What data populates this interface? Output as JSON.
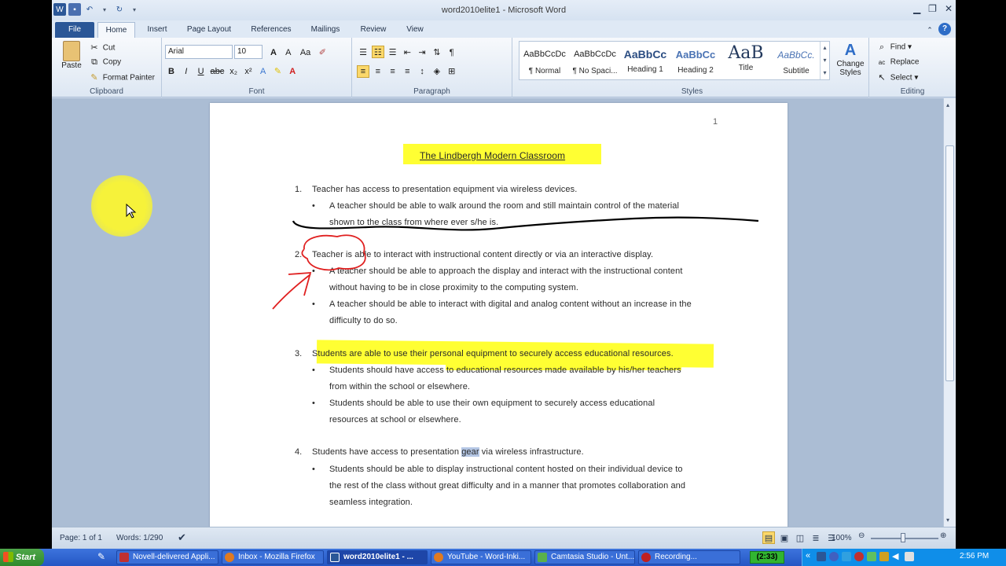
{
  "window": {
    "title": "word2010elite1 - Microsoft Word"
  },
  "tabs": [
    "File",
    "Home",
    "Insert",
    "Page Layout",
    "References",
    "Mailings",
    "Review",
    "View"
  ],
  "clipboard": {
    "paste": "Paste",
    "cut": "Cut",
    "copy": "Copy",
    "format_painter": "Format Painter",
    "label": "Clipboard"
  },
  "font": {
    "family": "Arial",
    "size": "10",
    "label": "Font"
  },
  "paragraph": {
    "label": "Paragraph"
  },
  "styles": {
    "label": "Styles",
    "items": [
      {
        "preview": "AaBbCcDc",
        "name": "¶ Normal"
      },
      {
        "preview": "AaBbCcDc",
        "name": "¶ No Spaci..."
      },
      {
        "preview": "AaBbCc",
        "name": "Heading 1"
      },
      {
        "preview": "AaBbCc",
        "name": "Heading 2"
      },
      {
        "preview": "AaB",
        "name": "Title"
      },
      {
        "preview": "AaBbCc.",
        "name": "Subtitle"
      }
    ],
    "change_styles": "Change Styles"
  },
  "editing": {
    "find": "Find",
    "replace": "Replace",
    "select": "Select",
    "label": "Editing"
  },
  "document": {
    "page_number": "1",
    "title": "The Lindbergh Modern Classroom",
    "items": [
      {
        "num": "1.",
        "text": "Teacher  has access to presentation equipment via wireless devices.",
        "bullets": [
          [
            "A teacher should be able to walk around the room and still maintain control of the material",
            "shown to the class from where ever s/he is."
          ]
        ]
      },
      {
        "num": "2.",
        "text": "Teacher  is able to interact with instructional content directly or via an interactive display.",
        "bullets": [
          [
            "A teacher should be able to approach the display and interact with the instructional content",
            "without having to be in close proximity to the computing system."
          ],
          [
            "A teacher should be able to interact with digital and analog content without an increase in the",
            "difficulty to do so."
          ]
        ]
      },
      {
        "num": "3.",
        "text": "Students are able to use their personal equipment to securely access educational resources.",
        "bullets": [
          [
            "Students should have access to educational resources made available by his/her teachers",
            "from within the school or elsewhere."
          ],
          [
            "Students should be able to use their own equipment to securely access educational",
            "resources at school or elsewhere."
          ]
        ]
      },
      {
        "num": "4.",
        "text_before": "Students have access to presentation ",
        "text_selected": "gear",
        "text_after": " via wireless infrastructure.",
        "bullets": [
          [
            "Students should be able to display instructional content hosted on their individual device to",
            "the rest of the class without great difficulty and in a manner that promotes collaboration and",
            "seamless integration."
          ]
        ]
      }
    ]
  },
  "status": {
    "page": "Page: 1 of 1",
    "words": "Words: 1/290",
    "zoom": "100%"
  },
  "taskbar": {
    "start": "Start",
    "tasks": [
      "Novell-delivered Appli...",
      "Inbox - Mozilla Firefox",
      "word2010elite1 - ...",
      "YouTube - Word-Inki...",
      "Camtasia Studio - Unt...",
      "Recording..."
    ],
    "timer": "(2:33)",
    "clock": "2:56 PM"
  },
  "colors": {
    "file_tab": "#2b5797",
    "highlight": "#ffff33",
    "selection": "#b4c6e4",
    "pen_black": "#000000",
    "pen_red": "#e02020",
    "cursor_halo": "#f2ee2a"
  }
}
